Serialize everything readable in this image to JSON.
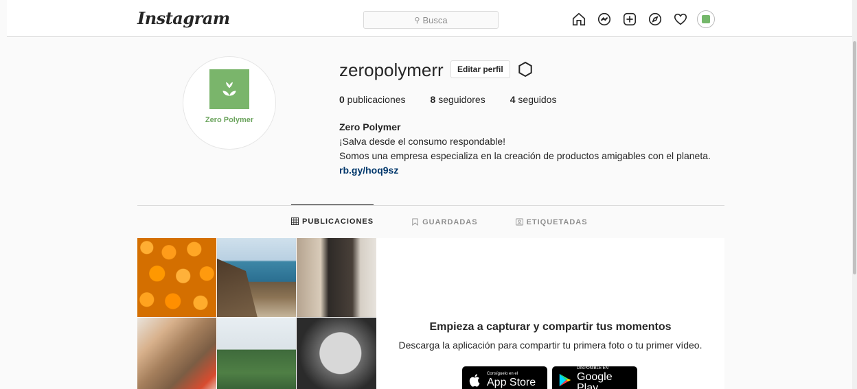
{
  "header": {
    "logo": "Instagram",
    "search_placeholder": "Busca",
    "icons": [
      "home-icon",
      "messenger-icon",
      "new-post-icon",
      "explore-icon",
      "activity-heart-icon",
      "profile-avatar"
    ]
  },
  "profile": {
    "avatar_text": "Zero Polymer",
    "username": "zeropolymerr",
    "edit_button": "Editar perfil",
    "stats": {
      "posts_count": "0",
      "posts_label": " publicaciones",
      "followers_count": "8",
      "followers_label": " seguidores",
      "following_count": "4",
      "following_label": " seguidos"
    },
    "full_name": "Zero Polymer",
    "bio_line1": "¡Salva desde el consumo respondable!",
    "bio_line2": "Somos una empresa especializa en la creación de productos amigables con el planeta.",
    "link": "rb.gy/hoq9sz"
  },
  "tabs": [
    {
      "label": "PUBLICACIONES",
      "icon": "grid-icon",
      "active": true
    },
    {
      "label": "GUARDADAS",
      "icon": "bookmark-icon",
      "active": false
    },
    {
      "label": "ETIQUETADAS",
      "icon": "tagged-icon",
      "active": false
    }
  ],
  "empty_state": {
    "title": "Empieza a capturar y compartir tus momentos",
    "subtitle": "Descarga la aplicación para compartir tu primera foto o tu primer vídeo.",
    "appstore_small": "Consíguelo en el",
    "appstore_big": "App Store",
    "googleplay_small": "DISPONIBLE EN",
    "googleplay_big": "Google Play"
  },
  "colors": {
    "brand_green": "#7ab56b",
    "link_blue": "#00376b",
    "border": "#dbdbdb"
  }
}
